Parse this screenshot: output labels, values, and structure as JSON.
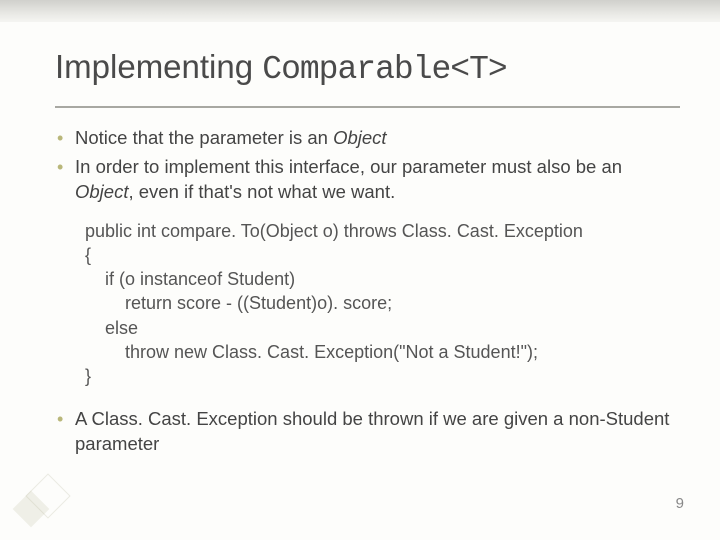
{
  "title": {
    "part1": "Implementing ",
    "part2": "Comparable<T>"
  },
  "bullets_top": [
    {
      "pre": "Notice that the parameter is an ",
      "em": "Object",
      "post": ""
    },
    {
      "pre": "In order to implement this interface, our parameter must also be an ",
      "em": "Object",
      "post": ", even if that's not what we want."
    }
  ],
  "code": "public int compare. To(Object o) throws Class. Cast. Exception\n{\n    if (o instanceof Student)\n        return score - ((Student)o). score;\n    else\n        throw new Class. Cast. Exception(\"Not a Student!\");\n}",
  "bullets_bottom": [
    {
      "seg": [
        {
          "t": "A ",
          "cls": ""
        },
        {
          "t": "Class. Cast. Exception",
          "cls": "mono-inline"
        },
        {
          "t": " should be thrown if we are given a non-",
          "cls": ""
        },
        {
          "t": "Student",
          "cls": "mono-inline"
        },
        {
          "t": " parameter",
          "cls": ""
        }
      ]
    }
  ],
  "page_number": "9"
}
